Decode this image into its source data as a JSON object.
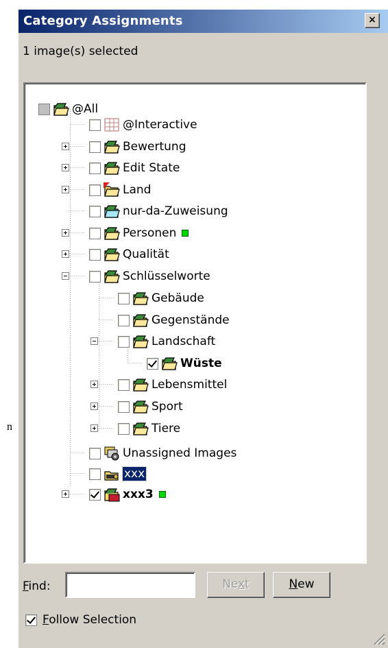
{
  "page_text": "n",
  "panel": {
    "title": "Category Assignments",
    "close_glyph": "×",
    "selection_info": "1 image(s) selected"
  },
  "tree": [
    {
      "label": "@All",
      "check": "gray",
      "expander": "minus",
      "icon": "folder-icon"
    },
    {
      "label": "@Interactive",
      "check": "none",
      "expander": "",
      "icon": "table-icon"
    },
    {
      "label": "Bewertung",
      "check": "none",
      "expander": "plus",
      "icon": "folder-icon"
    },
    {
      "label": "Edit State",
      "check": "none",
      "expander": "plus",
      "icon": "folder-icon"
    },
    {
      "label": "Land",
      "check": "none",
      "expander": "plus",
      "icon": "folder-flag-icon"
    },
    {
      "label": "nur-da-Zuweisung",
      "check": "none",
      "expander": "",
      "icon": "folder-cyan-icon"
    },
    {
      "label": "Personen",
      "check": "none",
      "expander": "plus",
      "icon": "folder-icon",
      "marker": true
    },
    {
      "label": "Qualität",
      "check": "none",
      "expander": "plus",
      "icon": "folder-icon"
    },
    {
      "label": "Schlüsselworte",
      "check": "none",
      "expander": "minus",
      "icon": "folder-icon"
    },
    {
      "label": "Gebäude",
      "check": "none",
      "expander": "",
      "icon": "folder-icon"
    },
    {
      "label": "Gegenstände",
      "check": "none",
      "expander": "",
      "icon": "folder-icon"
    },
    {
      "label": "Landschaft",
      "check": "none",
      "expander": "minus",
      "icon": "folder-icon"
    },
    {
      "label": "Wüste",
      "check": "checked",
      "expander": "",
      "icon": "folder-icon",
      "bold": true
    },
    {
      "label": "Lebensmittel",
      "check": "none",
      "expander": "plus",
      "icon": "folder-icon"
    },
    {
      "label": "Sport",
      "check": "none",
      "expander": "plus",
      "icon": "folder-icon"
    },
    {
      "label": "Tiere",
      "check": "none",
      "expander": "plus",
      "icon": "folder-icon"
    },
    {
      "label": "Unassigned Images",
      "check": "none",
      "expander": "",
      "icon": "unassigned-icon"
    },
    {
      "label": "xxx",
      "check": "none",
      "expander": "",
      "icon": "folder-key-icon",
      "selected": true
    },
    {
      "label": "xxx3",
      "check": "checked",
      "expander": "plus",
      "icon": "folder-red-icon",
      "bold": true,
      "marker": true
    }
  ],
  "find": {
    "label": "Find:",
    "value": "",
    "next_label": "Next",
    "new_label": "New"
  },
  "follow_selection": {
    "label": "Follow Selection",
    "checked": true
  }
}
